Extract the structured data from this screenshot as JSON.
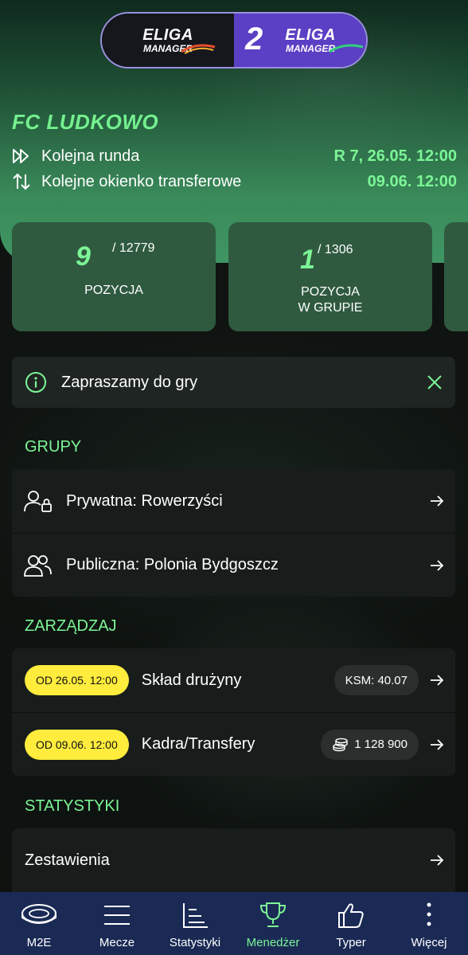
{
  "brand": {
    "left_title": "ELIGA",
    "left_sub": "MANAGER",
    "right_title": "ELIGA",
    "right_sub": "MANAGER"
  },
  "team": {
    "name": "FC LUDKOWO"
  },
  "info": {
    "next_round_label": "Kolejna runda",
    "next_round_value": "R 7, 26.05. 12:00",
    "transfer_label": "Kolejne okienko transferowe",
    "transfer_value": "09.06. 12:00"
  },
  "stats": [
    {
      "rank": "9",
      "total": "/ 12779",
      "label_line1": "POZYCJA",
      "label_line2": ""
    },
    {
      "rank": "1",
      "total": "/ 1306",
      "label_line1": "POZYCJA",
      "label_line2": "W GRUPIE"
    }
  ],
  "notice": {
    "text": "Zapraszamy do gry"
  },
  "groups": {
    "title": "GRUPY",
    "items": [
      {
        "label": "Prywatna: Rowerzyści",
        "icon": "private-group-icon"
      },
      {
        "label": "Publiczna: Polonia Bydgoszcz",
        "icon": "public-group-icon"
      }
    ]
  },
  "manage": {
    "title": "ZARZĄDZAJ",
    "items": [
      {
        "date": "OD 26.05. 12:00",
        "label": "Skład drużyny",
        "badge": "KSM: 40.07"
      },
      {
        "date": "OD 09.06. 12:00",
        "label": "Kadra/Transfery",
        "badge": "1 128 900"
      }
    ]
  },
  "statistics": {
    "title": "STATYSTYKI",
    "items": [
      {
        "label": "Zestawienia"
      }
    ]
  },
  "nav": {
    "items": [
      {
        "label": "M2E",
        "icon": "stadium-icon"
      },
      {
        "label": "Mecze",
        "icon": "menu-lines-icon"
      },
      {
        "label": "Statystyki",
        "icon": "bar-chart-icon"
      },
      {
        "label": "Menedżer",
        "icon": "trophy-icon"
      },
      {
        "label": "Typer",
        "icon": "thumbs-up-icon"
      },
      {
        "label": "Więcej",
        "icon": "more-icon"
      }
    ],
    "active": "Menedżer"
  },
  "colors": {
    "accent": "#7cf596",
    "card_bg": "#2f5a40",
    "nav_bg": "#1a2a55",
    "yellow": "#ffec3d",
    "logo_purple": "#5b3fc4"
  }
}
